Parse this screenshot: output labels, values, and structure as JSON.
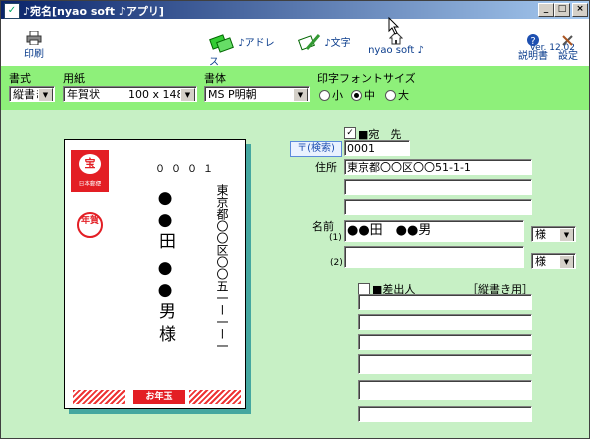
{
  "window": {
    "title": "♪宛名[nyao soft ♪アプリ]",
    "minimize": "_",
    "maximize": "□",
    "close": "×"
  },
  "toolbar": {
    "print_label": "印刷",
    "address_label": "♪アドレス",
    "text_label": "♪文字",
    "home_label": "nyao soft ♪",
    "help_label": "説明書",
    "settings_label": "設定",
    "version": "Ver. 12.02"
  },
  "options": {
    "format_label": "書式",
    "format_value": "縦書き",
    "paper_label": "用紙",
    "paper_value": "年賀状        100 x 148",
    "font_label": "書体",
    "font_value": "MS P明朝",
    "size_label": "印字フォントサイズ",
    "size_options": [
      "小",
      "中",
      "大"
    ],
    "size_selected": "中"
  },
  "card": {
    "postal": "０００１",
    "address": "東京都〇〇区〇〇五一ー一ー一",
    "name_family": "●●田",
    "name_given": "●●男",
    "honorific": "様",
    "stamp_text": "日本郵便",
    "nenga_mark": "年賀",
    "otoshidama": "お年玉"
  },
  "form": {
    "recipient_label": "■宛　先",
    "recipient_checked": true,
    "postal_search_button": "〒(検索)",
    "postal_value": "0001",
    "address_label": "住所",
    "address_line1": "東京都〇〇区〇〇51-1-1",
    "address_line2": "",
    "address_line3": "",
    "name_label": "名前",
    "name1_marker": "(1)",
    "name1_value": "●●田　●●男",
    "name1_honorific": "様",
    "name2_marker": "(2)",
    "name2_value": "",
    "name2_honorific": "様",
    "sender_label": "■差出人",
    "sender_checked": false,
    "sender_mode": "［縦書き用］"
  }
}
